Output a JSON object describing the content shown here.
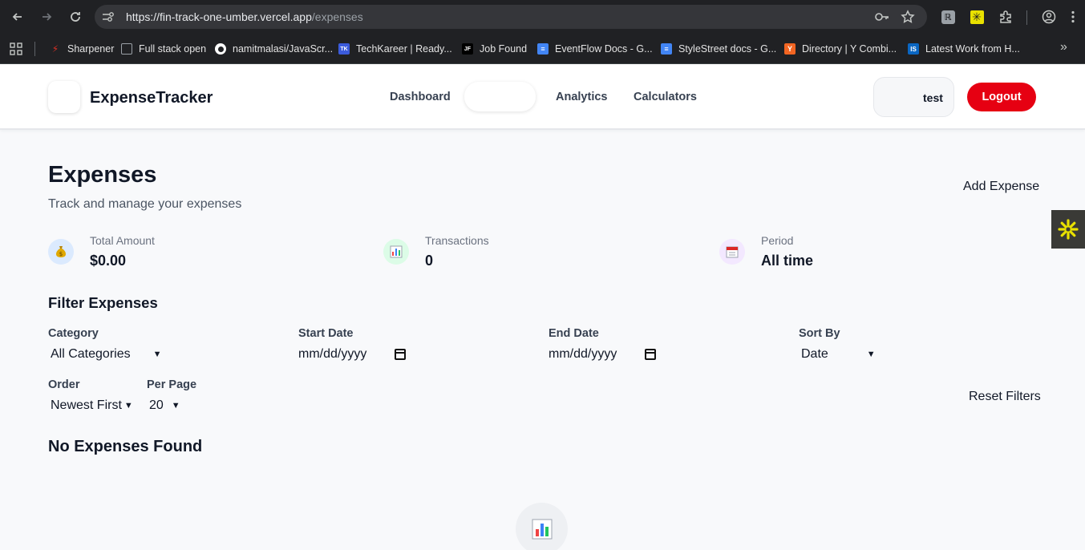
{
  "browser": {
    "url_host": "https://fin-track-one-umber.vercel.app",
    "url_path": "/expenses",
    "bookmarks": [
      {
        "label": "Sharpener",
        "color": "#d93025",
        "glyph": "⚡"
      },
      {
        "label": "Full stack open",
        "color": "#202124",
        "glyph": ""
      },
      {
        "label": "namitmalasi/JavaScr...",
        "color": "#ffffff",
        "glyph": ""
      },
      {
        "label": "TechKareer | Ready...",
        "color": "#3b5bdb",
        "glyph": "TK"
      },
      {
        "label": "Job Found",
        "color": "#000000",
        "glyph": "JF"
      },
      {
        "label": "EventFlow Docs - G...",
        "color": "#4285f4",
        "glyph": "≡"
      },
      {
        "label": "StyleStreet docs - G...",
        "color": "#4285f4",
        "glyph": "≡"
      },
      {
        "label": "Directory | Y Combi...",
        "color": "#f26522",
        "glyph": "Y"
      },
      {
        "label": "Latest Work from H...",
        "color": "#0a66c2",
        "glyph": "IS"
      }
    ]
  },
  "header": {
    "brand": "ExpenseTracker",
    "nav": {
      "dashboard": "Dashboard",
      "expenses": "",
      "analytics": "Analytics",
      "calculators": "Calculators"
    },
    "user_name": "test",
    "logout_label": "Logout",
    "logout_color": "#e60012"
  },
  "page": {
    "title": "Expenses",
    "subtitle": "Track and manage your expenses",
    "add_label": "Add Expense"
  },
  "stats": {
    "total": {
      "label": "Total Amount",
      "value": "$0.00",
      "icon": "money-bag-icon"
    },
    "transactions": {
      "label": "Transactions",
      "value": "0",
      "icon": "bar-chart-icon"
    },
    "period": {
      "label": "Period",
      "value": "All time",
      "icon": "calendar-icon"
    }
  },
  "filters": {
    "heading": "Filter Expenses",
    "category": {
      "label": "Category",
      "value": "All Categories"
    },
    "start_date": {
      "label": "Start Date",
      "placeholder": "mm/dd/yyyy"
    },
    "end_date": {
      "label": "End Date",
      "placeholder": "mm/dd/yyyy"
    },
    "sort_by": {
      "label": "Sort By",
      "value": "Date"
    },
    "order": {
      "label": "Order",
      "value": "Newest First"
    },
    "per_page": {
      "label": "Per Page",
      "value": "20"
    },
    "reset_label": "Reset Filters"
  },
  "empty": {
    "title": "No Expenses Found",
    "icon": "bar-chart-icon"
  }
}
